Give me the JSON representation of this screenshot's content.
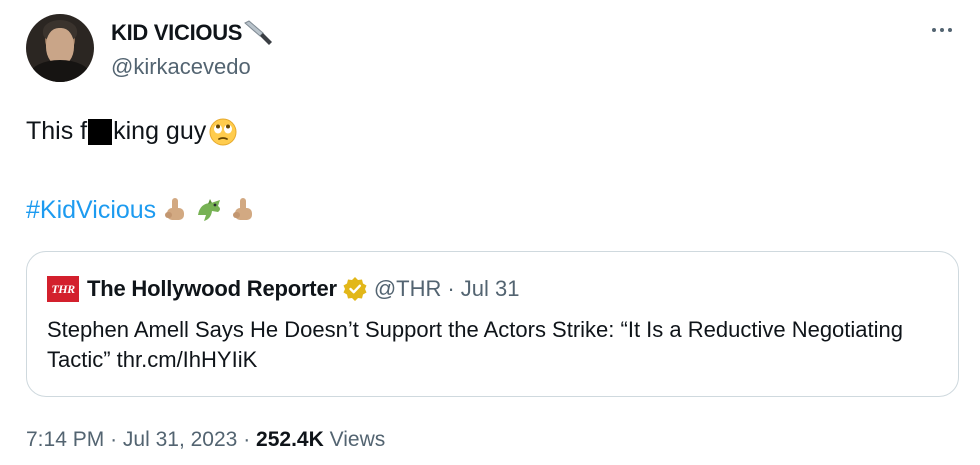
{
  "author": {
    "display_name": "KID VICIOUS",
    "name_emoji": "knife-icon",
    "handle": "@kirkacevedo"
  },
  "tweet": {
    "text_before": "This f",
    "text_after": "king guy",
    "text_emoji": "face-with-rolling-eyes-icon",
    "hashtag": "#KidVicious",
    "hashtag_emojis": [
      "middle-finger-icon",
      "dragon-icon",
      "middle-finger-icon"
    ]
  },
  "quote": {
    "logo_text": "THR",
    "name": "The Hollywood Reporter",
    "handle": "@THR",
    "separator": "·",
    "date": "Jul 31",
    "text": "Stephen Amell Says He Doesn’t Support the Actors Strike: “It Is a Reductive Negotiating Tactic” thr.cm/IhHYIiK"
  },
  "footer": {
    "time": "7:14 PM",
    "separator": "·",
    "date": "Jul 31, 2023",
    "views_count": "252.4K",
    "views_label": "Views"
  },
  "colors": {
    "link": "#1d9bf0",
    "secondary_text": "#536471",
    "border": "#cfd9de",
    "thr_red": "#d3202d",
    "verified_gold": "#e2b719"
  }
}
